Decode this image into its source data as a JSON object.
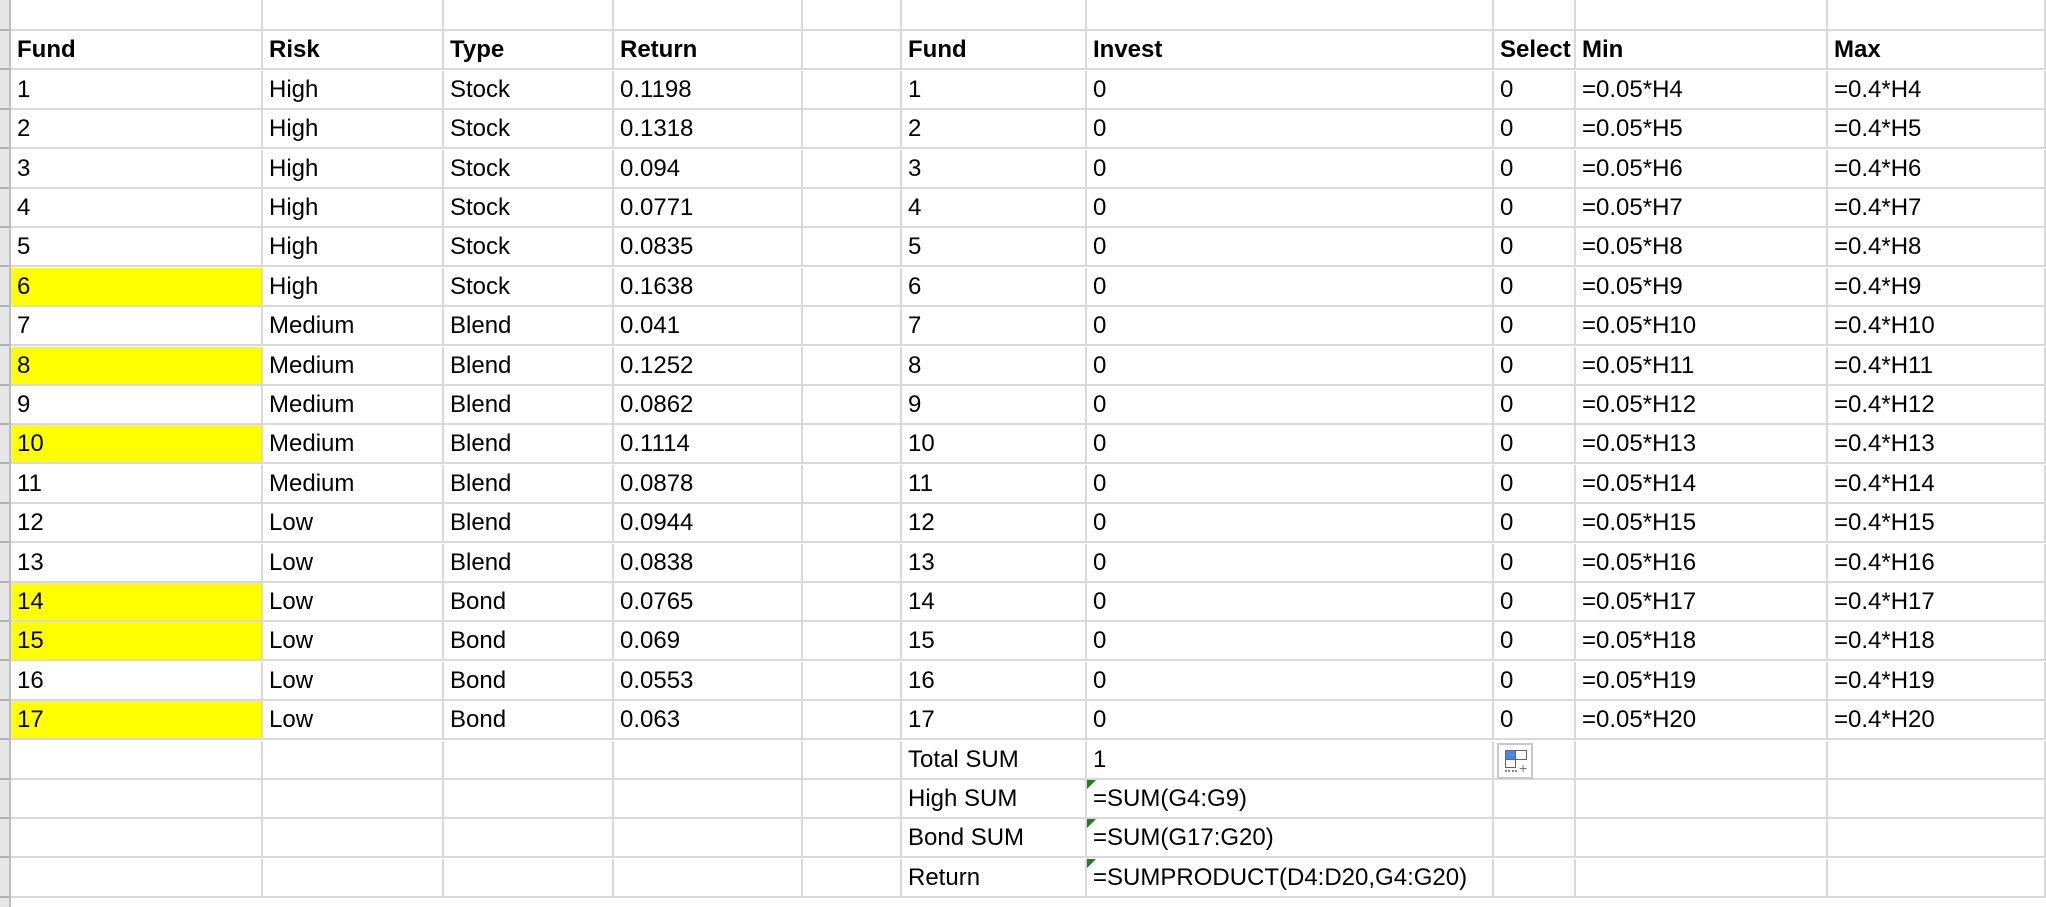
{
  "sheet": {
    "highlight_color": "#FFFF00",
    "left_table": {
      "headers": [
        "Fund",
        "Risk",
        "Type",
        "Return"
      ],
      "rows": [
        {
          "fund": "1",
          "risk": "High",
          "type": "Stock",
          "return": "0.1198",
          "highlight": false
        },
        {
          "fund": "2",
          "risk": "High",
          "type": "Stock",
          "return": "0.1318",
          "highlight": false
        },
        {
          "fund": "3",
          "risk": "High",
          "type": "Stock",
          "return": "0.094",
          "highlight": false
        },
        {
          "fund": "4",
          "risk": "High",
          "type": "Stock",
          "return": "0.0771",
          "highlight": false
        },
        {
          "fund": "5",
          "risk": "High",
          "type": "Stock",
          "return": "0.0835",
          "highlight": false
        },
        {
          "fund": "6",
          "risk": "High",
          "type": "Stock",
          "return": "0.1638",
          "highlight": true
        },
        {
          "fund": "7",
          "risk": "Medium",
          "type": "Blend",
          "return": "0.041",
          "highlight": false
        },
        {
          "fund": "8",
          "risk": "Medium",
          "type": "Blend",
          "return": "0.1252",
          "highlight": true
        },
        {
          "fund": "9",
          "risk": "Medium",
          "type": "Blend",
          "return": "0.0862",
          "highlight": false
        },
        {
          "fund": "10",
          "risk": "Medium",
          "type": "Blend",
          "return": "0.1114",
          "highlight": true
        },
        {
          "fund": "11",
          "risk": "Medium",
          "type": "Blend",
          "return": "0.0878",
          "highlight": false
        },
        {
          "fund": "12",
          "risk": "Low",
          "type": "Blend",
          "return": "0.0944",
          "highlight": false
        },
        {
          "fund": "13",
          "risk": "Low",
          "type": "Blend",
          "return": "0.0838",
          "highlight": false
        },
        {
          "fund": "14",
          "risk": "Low",
          "type": "Bond",
          "return": "0.0765",
          "highlight": true
        },
        {
          "fund": "15",
          "risk": "Low",
          "type": "Bond",
          "return": "0.069",
          "highlight": true
        },
        {
          "fund": "16",
          "risk": "Low",
          "type": "Bond",
          "return": "0.0553",
          "highlight": false
        },
        {
          "fund": "17",
          "risk": "Low",
          "type": "Bond",
          "return": "0.063",
          "highlight": true
        }
      ]
    },
    "right_table": {
      "headers": [
        "Fund",
        "Invest",
        "Select",
        "Min",
        "Max"
      ],
      "rows": [
        {
          "fund": "1",
          "invest": "0",
          "select": "0",
          "min": "=0.05*H4",
          "max": "=0.4*H4"
        },
        {
          "fund": "2",
          "invest": "0",
          "select": "0",
          "min": "=0.05*H5",
          "max": "=0.4*H5"
        },
        {
          "fund": "3",
          "invest": "0",
          "select": "0",
          "min": "=0.05*H6",
          "max": "=0.4*H6"
        },
        {
          "fund": "4",
          "invest": "0",
          "select": "0",
          "min": "=0.05*H7",
          "max": "=0.4*H7"
        },
        {
          "fund": "5",
          "invest": "0",
          "select": "0",
          "min": "=0.05*H8",
          "max": "=0.4*H8"
        },
        {
          "fund": "6",
          "invest": "0",
          "select": "0",
          "min": "=0.05*H9",
          "max": "=0.4*H9"
        },
        {
          "fund": "7",
          "invest": "0",
          "select": "0",
          "min": "=0.05*H10",
          "max": "=0.4*H10"
        },
        {
          "fund": "8",
          "invest": "0",
          "select": "0",
          "min": "=0.05*H11",
          "max": "=0.4*H11"
        },
        {
          "fund": "9",
          "invest": "0",
          "select": "0",
          "min": "=0.05*H12",
          "max": "=0.4*H12"
        },
        {
          "fund": "10",
          "invest": "0",
          "select": "0",
          "min": "=0.05*H13",
          "max": "=0.4*H13"
        },
        {
          "fund": "11",
          "invest": "0",
          "select": "0",
          "min": "=0.05*H14",
          "max": "=0.4*H14"
        },
        {
          "fund": "12",
          "invest": "0",
          "select": "0",
          "min": "=0.05*H15",
          "max": "=0.4*H15"
        },
        {
          "fund": "13",
          "invest": "0",
          "select": "0",
          "min": "=0.05*H16",
          "max": "=0.4*H16"
        },
        {
          "fund": "14",
          "invest": "0",
          "select": "0",
          "min": "=0.05*H17",
          "max": "=0.4*H17"
        },
        {
          "fund": "15",
          "invest": "0",
          "select": "0",
          "min": "=0.05*H18",
          "max": "=0.4*H18"
        },
        {
          "fund": "16",
          "invest": "0",
          "select": "0",
          "min": "=0.05*H19",
          "max": "=0.4*H19"
        },
        {
          "fund": "17",
          "invest": "0",
          "select": "0",
          "min": "=0.05*H20",
          "max": "=0.4*H20"
        }
      ],
      "summary": [
        {
          "label": "Total SUM",
          "value": "1",
          "warning": false
        },
        {
          "label": "High SUM",
          "value": "=SUM(G4:G9)",
          "warning": true
        },
        {
          "label": "Bond SUM",
          "value": "=SUM(G17:G20)",
          "warning": true
        },
        {
          "label": "Return",
          "value": "=SUMPRODUCT(D4:D20,G4:G20)",
          "warning": true
        }
      ]
    },
    "paste_options_icon": "paste-options-icon"
  }
}
